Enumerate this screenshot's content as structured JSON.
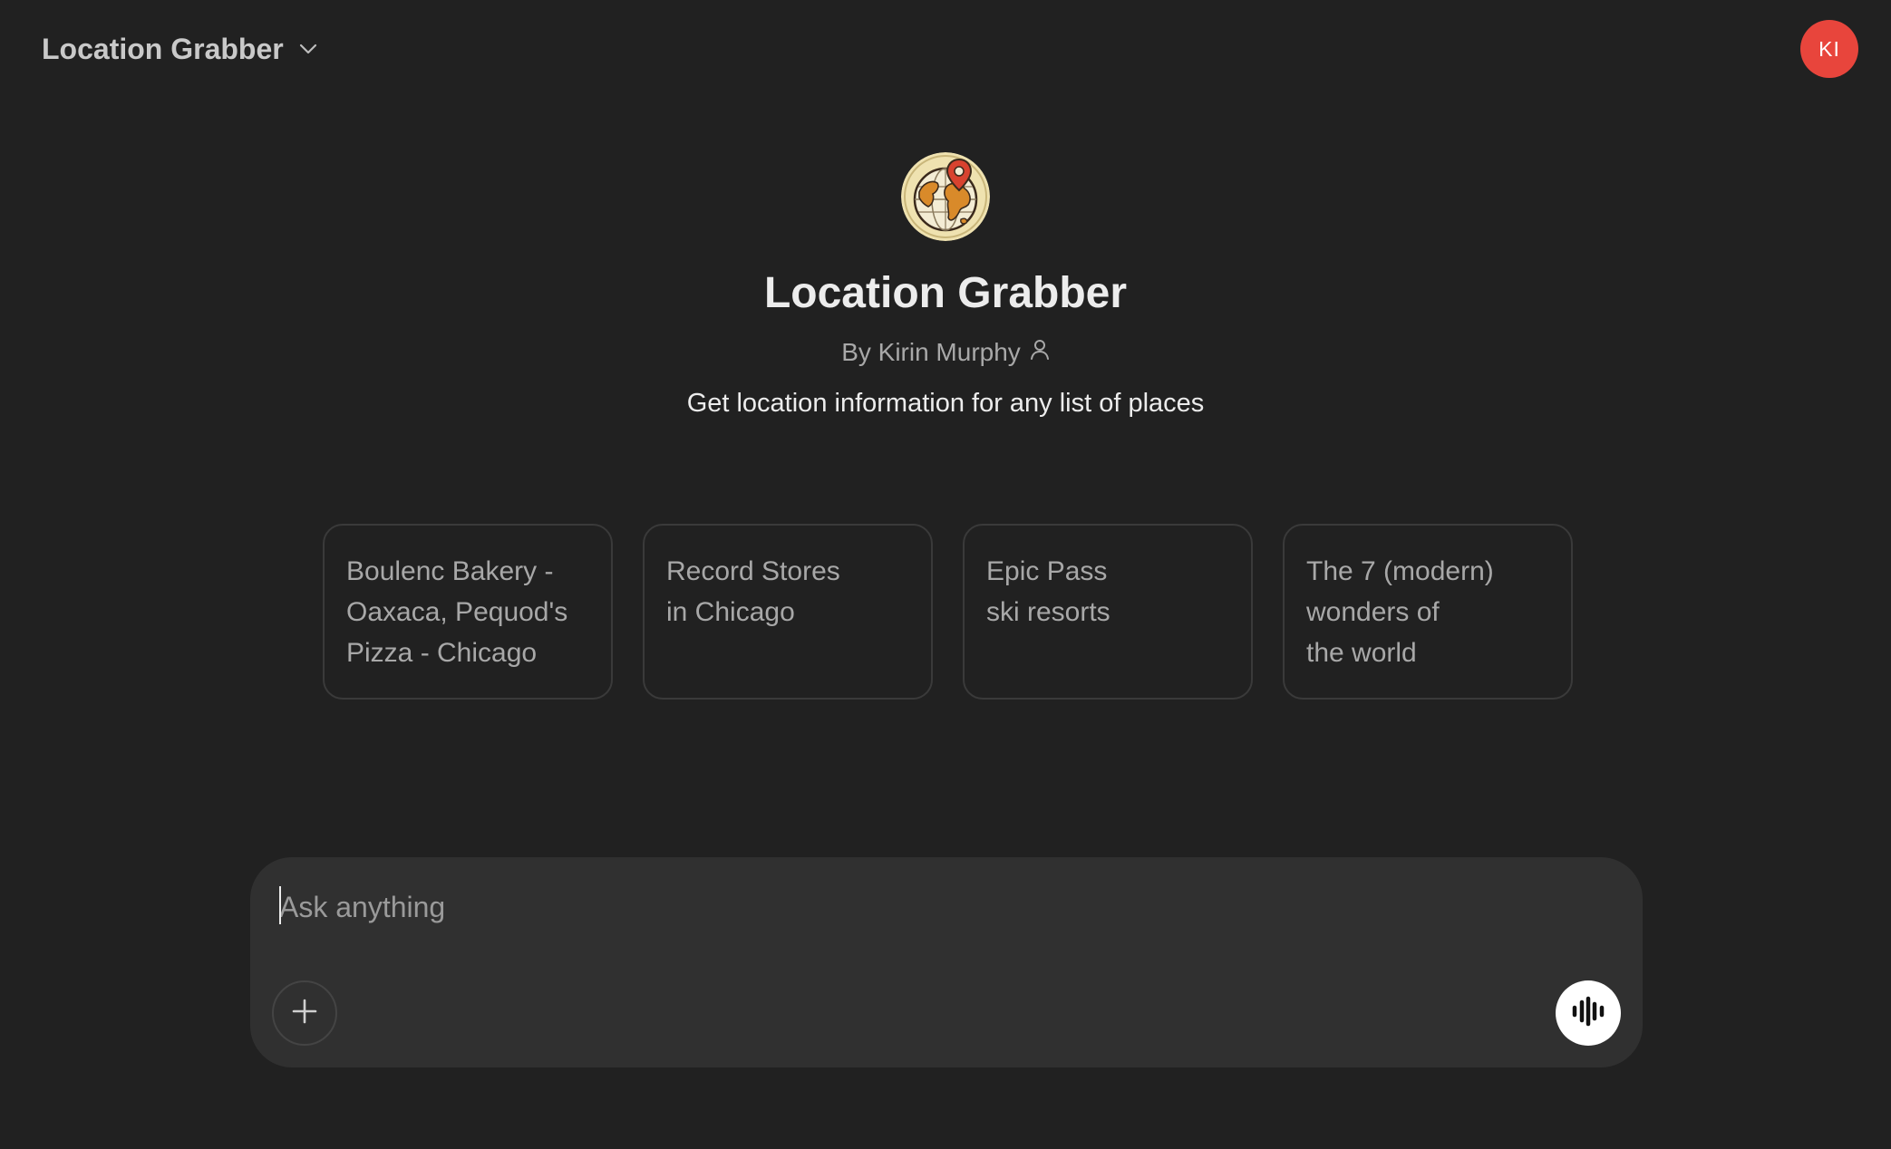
{
  "header": {
    "model_name": "Location Grabber",
    "dropdown_icon": "chevron-down-icon",
    "avatar_initials": "KI",
    "avatar_color": "#e8453c"
  },
  "gpt": {
    "logo_icon": "globe-location-pin-icon",
    "name": "Location Grabber",
    "author": "By Kirin Murphy",
    "author_icon": "person-icon",
    "description": "Get location information for any list of places"
  },
  "starters": [
    {
      "lines": [
        "Boulenc Bakery -",
        "Oaxaca, Pequod's",
        "Pizza - Chicago"
      ]
    },
    {
      "lines": [
        "Record Stores",
        "in Chicago"
      ]
    },
    {
      "lines": [
        "Epic Pass",
        "ski resorts"
      ]
    },
    {
      "lines": [
        "The 7 (modern)",
        "wonders of",
        "the world"
      ]
    }
  ],
  "composer": {
    "placeholder": "Ask anything",
    "value": "",
    "attach_icon": "plus-icon",
    "voice_icon": "voice-waveform-icon"
  },
  "colors": {
    "background": "#212121",
    "composer_bg": "#303030",
    "text_primary": "#ececec",
    "text_muted": "#a8a8a8"
  }
}
